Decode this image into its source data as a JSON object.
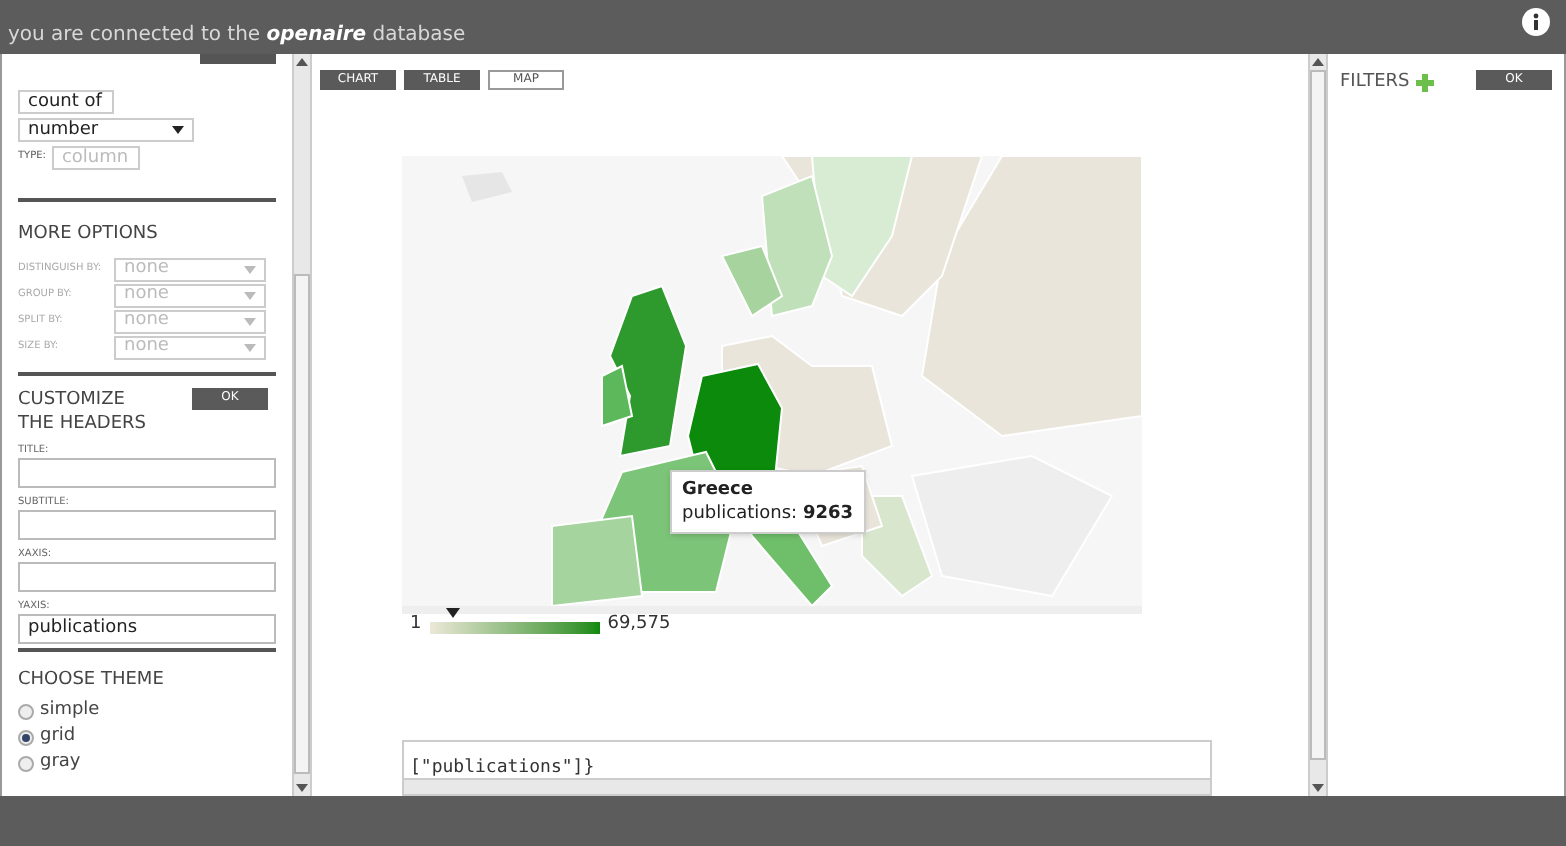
{
  "header": {
    "text": "you are connected to the **openaire** database"
  },
  "sidebar": {
    "measure": {
      "aggregate": "count of",
      "field": "number",
      "type_label": "TYPE:",
      "type_value": "column",
      "type_disabled": true
    },
    "more_options": {
      "title": "MORE OPTIONS",
      "options": [
        {
          "label": "DISTINGUISH BY:",
          "value": "none",
          "disabled": true
        },
        {
          "label": "GROUP BY:",
          "value": "none",
          "disabled": true
        },
        {
          "label": "SPLIT BY:",
          "value": "none",
          "disabled": true
        },
        {
          "label": "SIZE BY:",
          "value": "none",
          "disabled": true
        }
      ]
    },
    "headers": {
      "title": "CUSTOMIZE THE HEADERS",
      "ok": "OK",
      "fields": [
        {
          "label": "TITLE:"
        },
        {
          "label": "SUBTITLE:"
        },
        {
          "label": "XAXIS:"
        },
        {
          "label": "YAXIS:",
          "value": "publications"
        }
      ]
    },
    "theme": {
      "title": "CHOOSE THEME",
      "options": [
        {
          "label": "simple",
          "selected": false
        },
        {
          "label": "grid",
          "selected": true
        },
        {
          "label": "gray",
          "selected": false
        }
      ]
    }
  },
  "view_tabs": [
    {
      "label": "CHART",
      "selected": false
    },
    {
      "label": "TABLE",
      "selected": false
    },
    {
      "label": "MAP",
      "selected": true
    }
  ],
  "map": {
    "tooltip": {
      "title": "Greece",
      "label": "publications:",
      "value": "9263"
    },
    "legend": {
      "min": "1",
      "max": "69,575",
      "level": 0.13
    }
  },
  "code": "[\"publications\"]}",
  "filters": {
    "title": "FILTERS",
    "ok": "OK"
  }
}
